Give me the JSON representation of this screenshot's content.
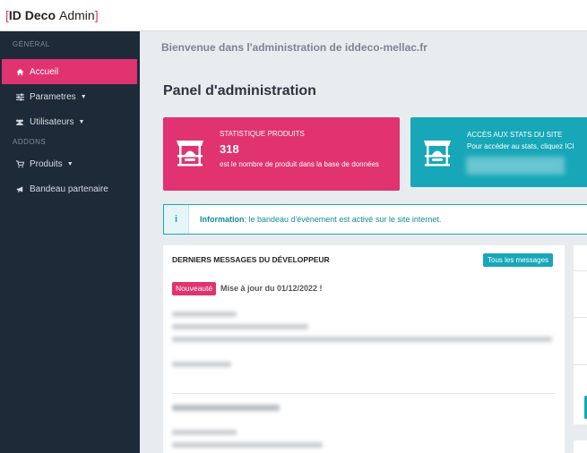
{
  "brand": {
    "left_bracket": "[",
    "name_bold": "ID Deco",
    "name_rest": "Admin",
    "right_bracket": "]"
  },
  "sidebar": {
    "sections": [
      {
        "title": "GÉNÉRAL"
      },
      {
        "title": "ADDONS"
      }
    ],
    "items": [
      {
        "label": "Accueil",
        "icon": "home-icon",
        "active": true
      },
      {
        "label": "Parametres",
        "icon": "sliders-icon",
        "has_caret": true
      },
      {
        "label": "Utilisateurs",
        "icon": "users-icon",
        "has_caret": true
      },
      {
        "label": "Produits",
        "icon": "cart-icon",
        "has_caret": true
      },
      {
        "label": "Bandeau partenaire",
        "icon": "megaphone-icon"
      }
    ]
  },
  "main": {
    "welcome": "Bienvenue dans l'administration de iddeco-mellac.fr",
    "title": "Panel d'administration",
    "stats_card": {
      "title": "STATISTIQUE PRODUITS",
      "value": "318",
      "description": "est le nombre de produit dans la base de données",
      "icon": "shop-icon",
      "color": "#e0336f"
    },
    "access_card": {
      "title": "ACCÈS AUX STATS DU SITE",
      "subtitle": "Pour accéder au stats, cliquez ICI",
      "icon": "shop-icon",
      "color": "#17a7b8"
    },
    "info": {
      "label": "Information",
      "text": ": le bandeau d'évènement est activé sur le site internet.",
      "icon": "info-icon"
    },
    "dev_panel": {
      "heading": "DERNIERS MESSAGES DU DÉVELOPPEUR",
      "all_button": "Tous les messages",
      "badge": "Nouveauté",
      "message_title": "Mise à jour du 01/12/2022 !"
    }
  }
}
